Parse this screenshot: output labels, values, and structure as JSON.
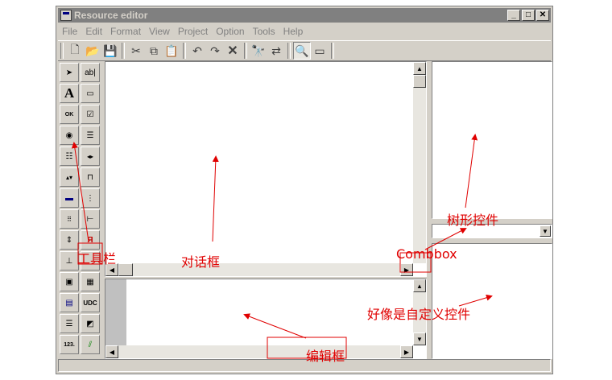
{
  "window": {
    "title": "Resource editor"
  },
  "menu": [
    {
      "label": "File"
    },
    {
      "label": "Edit"
    },
    {
      "label": "Format"
    },
    {
      "label": "View"
    },
    {
      "label": "Project"
    },
    {
      "label": "Option"
    },
    {
      "label": "Tools"
    },
    {
      "label": "Help"
    }
  ],
  "palette_labels": {
    "edit": "ab|",
    "static": "A",
    "ok": "OK",
    "udc": "UDC",
    "num": "123."
  },
  "annotations": {
    "toolbar": "工具栏",
    "dialog": "对话框",
    "tree": "树形控件",
    "combobox": "Combbox",
    "custom": "好像是自定义控件",
    "editor": "编辑框"
  },
  "colors": {
    "annotation": "#e00000",
    "face": "#d4d0c8"
  }
}
